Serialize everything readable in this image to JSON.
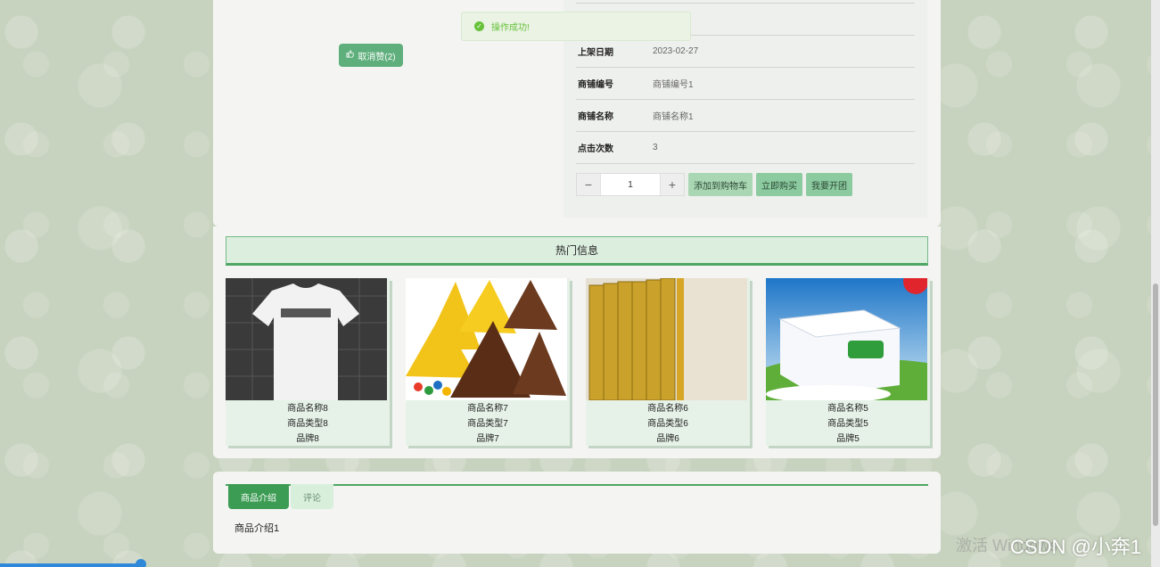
{
  "detail": {
    "unlike_button": "取消赞(2)",
    "info_rows": [
      {
        "key": "上架日期",
        "value": "2023-02-27"
      },
      {
        "key": "商铺编号",
        "value": "商铺编号1"
      },
      {
        "key": "商铺名称",
        "value": "商铺名称1"
      },
      {
        "key": "点击次数",
        "value": "3"
      }
    ],
    "quantity": {
      "minus": "−",
      "value": "1",
      "plus": "+"
    },
    "buttons": {
      "add_cart": "添加到购物车",
      "buy_now": "立即购买",
      "group_buy": "我要开团"
    }
  },
  "toast": {
    "message": "操作成功!",
    "icon": "check-circle-icon",
    "color": "#67c23a"
  },
  "hot": {
    "title": "热门信息",
    "items": [
      {
        "name": "商品名称8",
        "type": "商品类型8",
        "brand": "品牌8",
        "image": "tshirt-image"
      },
      {
        "name": "商品名称7",
        "type": "商品类型7",
        "brand": "品牌7",
        "image": "chocolate-image"
      },
      {
        "name": "商品名称6",
        "type": "商品类型6",
        "brand": "品牌6",
        "image": "books-image"
      },
      {
        "name": "商品名称5",
        "type": "商品类型5",
        "brand": "品牌5",
        "image": "milk-box-image"
      }
    ]
  },
  "tabs": [
    {
      "label": "商品介绍",
      "active": true
    },
    {
      "label": "评论",
      "active": false
    }
  ],
  "intro_text": "商品介绍1",
  "watermark": "激活 Windows",
  "csdn": "CSDN @小奔1",
  "colors": {
    "primary": "#4fa663",
    "accent": "#5faf7c",
    "toast": "#67c23a"
  }
}
